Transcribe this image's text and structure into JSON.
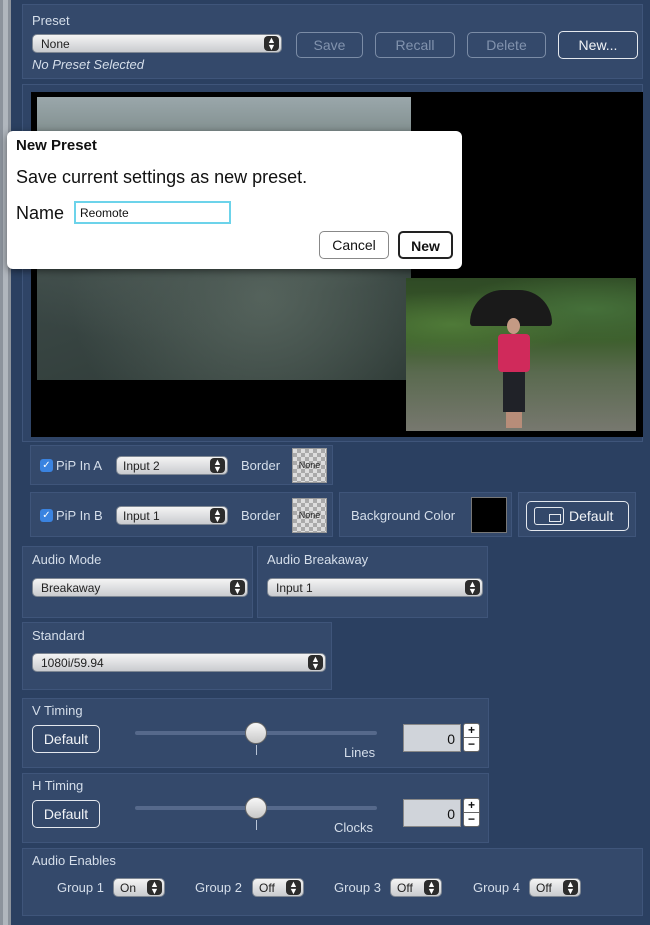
{
  "preset": {
    "section_label": "Preset",
    "selected": "None",
    "status": "No Preset Selected",
    "save_label": "Save",
    "recall_label": "Recall",
    "delete_label": "Delete",
    "new_label": "New..."
  },
  "dialog": {
    "title": "New Preset",
    "message": "Save current settings as new preset.",
    "name_label": "Name",
    "name_value": "Reomote",
    "cancel_label": "Cancel",
    "new_label": "New"
  },
  "pip_a": {
    "label": "PiP In A",
    "checked": true,
    "input": "Input 2",
    "border_label": "Border",
    "border_value": "None"
  },
  "pip_b": {
    "label": "PiP In B",
    "checked": true,
    "input": "Input 1",
    "border_label": "Border",
    "border_value": "None"
  },
  "background": {
    "label": "Background Color",
    "color": "#000000",
    "default_label": "Default"
  },
  "audio": {
    "mode_label": "Audio Mode",
    "mode_value": "Breakaway",
    "breakaway_label": "Audio Breakaway",
    "breakaway_value": "Input 1"
  },
  "standard": {
    "label": "Standard",
    "value": "1080i/59.94"
  },
  "v_timing": {
    "label": "V Timing",
    "default_label": "Default",
    "units": "Lines",
    "value": "0"
  },
  "h_timing": {
    "label": "H Timing",
    "default_label": "Default",
    "units": "Clocks",
    "value": "0"
  },
  "audio_enables": {
    "label": "Audio Enables",
    "groups": [
      {
        "label": "Group 1",
        "value": "On"
      },
      {
        "label": "Group 2",
        "value": "Off"
      },
      {
        "label": "Group 3",
        "value": "Off"
      },
      {
        "label": "Group 4",
        "value": "Off"
      }
    ]
  },
  "colors": {
    "background": "#2b4061",
    "panel": "#34496b",
    "checkbox": "#3a83e0",
    "dialog_input_focus": "#6cd3ea"
  }
}
